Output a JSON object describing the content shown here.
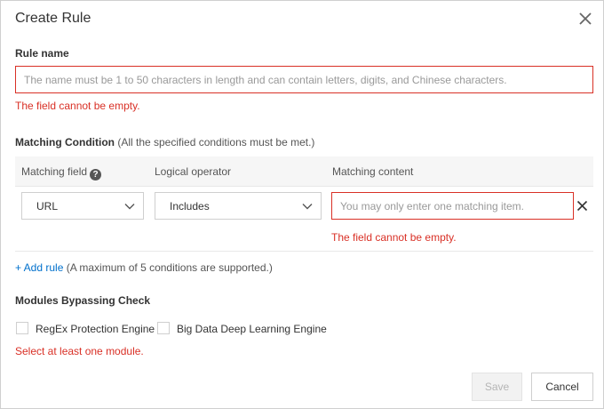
{
  "dialog": {
    "title": "Create Rule",
    "close_icon": "close-icon"
  },
  "rule_name": {
    "label": "Rule name",
    "placeholder": "The name must be 1 to 50 characters in length and can contain letters, digits, and Chinese characters.",
    "value": "",
    "error": "The field cannot be empty."
  },
  "matching_condition": {
    "title": "Matching Condition",
    "note": "(All the specified conditions must be met.)",
    "columns": {
      "field": "Matching field",
      "operator": "Logical operator",
      "content": "Matching content"
    },
    "help_icon": "question-circle-icon",
    "rows": [
      {
        "field": "URL",
        "operator": "Includes",
        "content_placeholder": "You may only enter one matching item.",
        "content_value": "",
        "error": "The field cannot be empty."
      }
    ],
    "add_rule": "+ Add rule",
    "add_rule_note": "(A maximum of 5 conditions are supported.)"
  },
  "modules": {
    "title": "Modules Bypassing Check",
    "options": [
      {
        "label": "RegEx Protection Engine",
        "checked": false
      },
      {
        "label": "Big Data Deep Learning Engine",
        "checked": false
      }
    ],
    "error": "Select at least one module."
  },
  "footer": {
    "save_label": "Save",
    "cancel_label": "Cancel"
  },
  "colors": {
    "error": "#d93026",
    "link": "#0070cc",
    "border": "#cfcfcf"
  }
}
